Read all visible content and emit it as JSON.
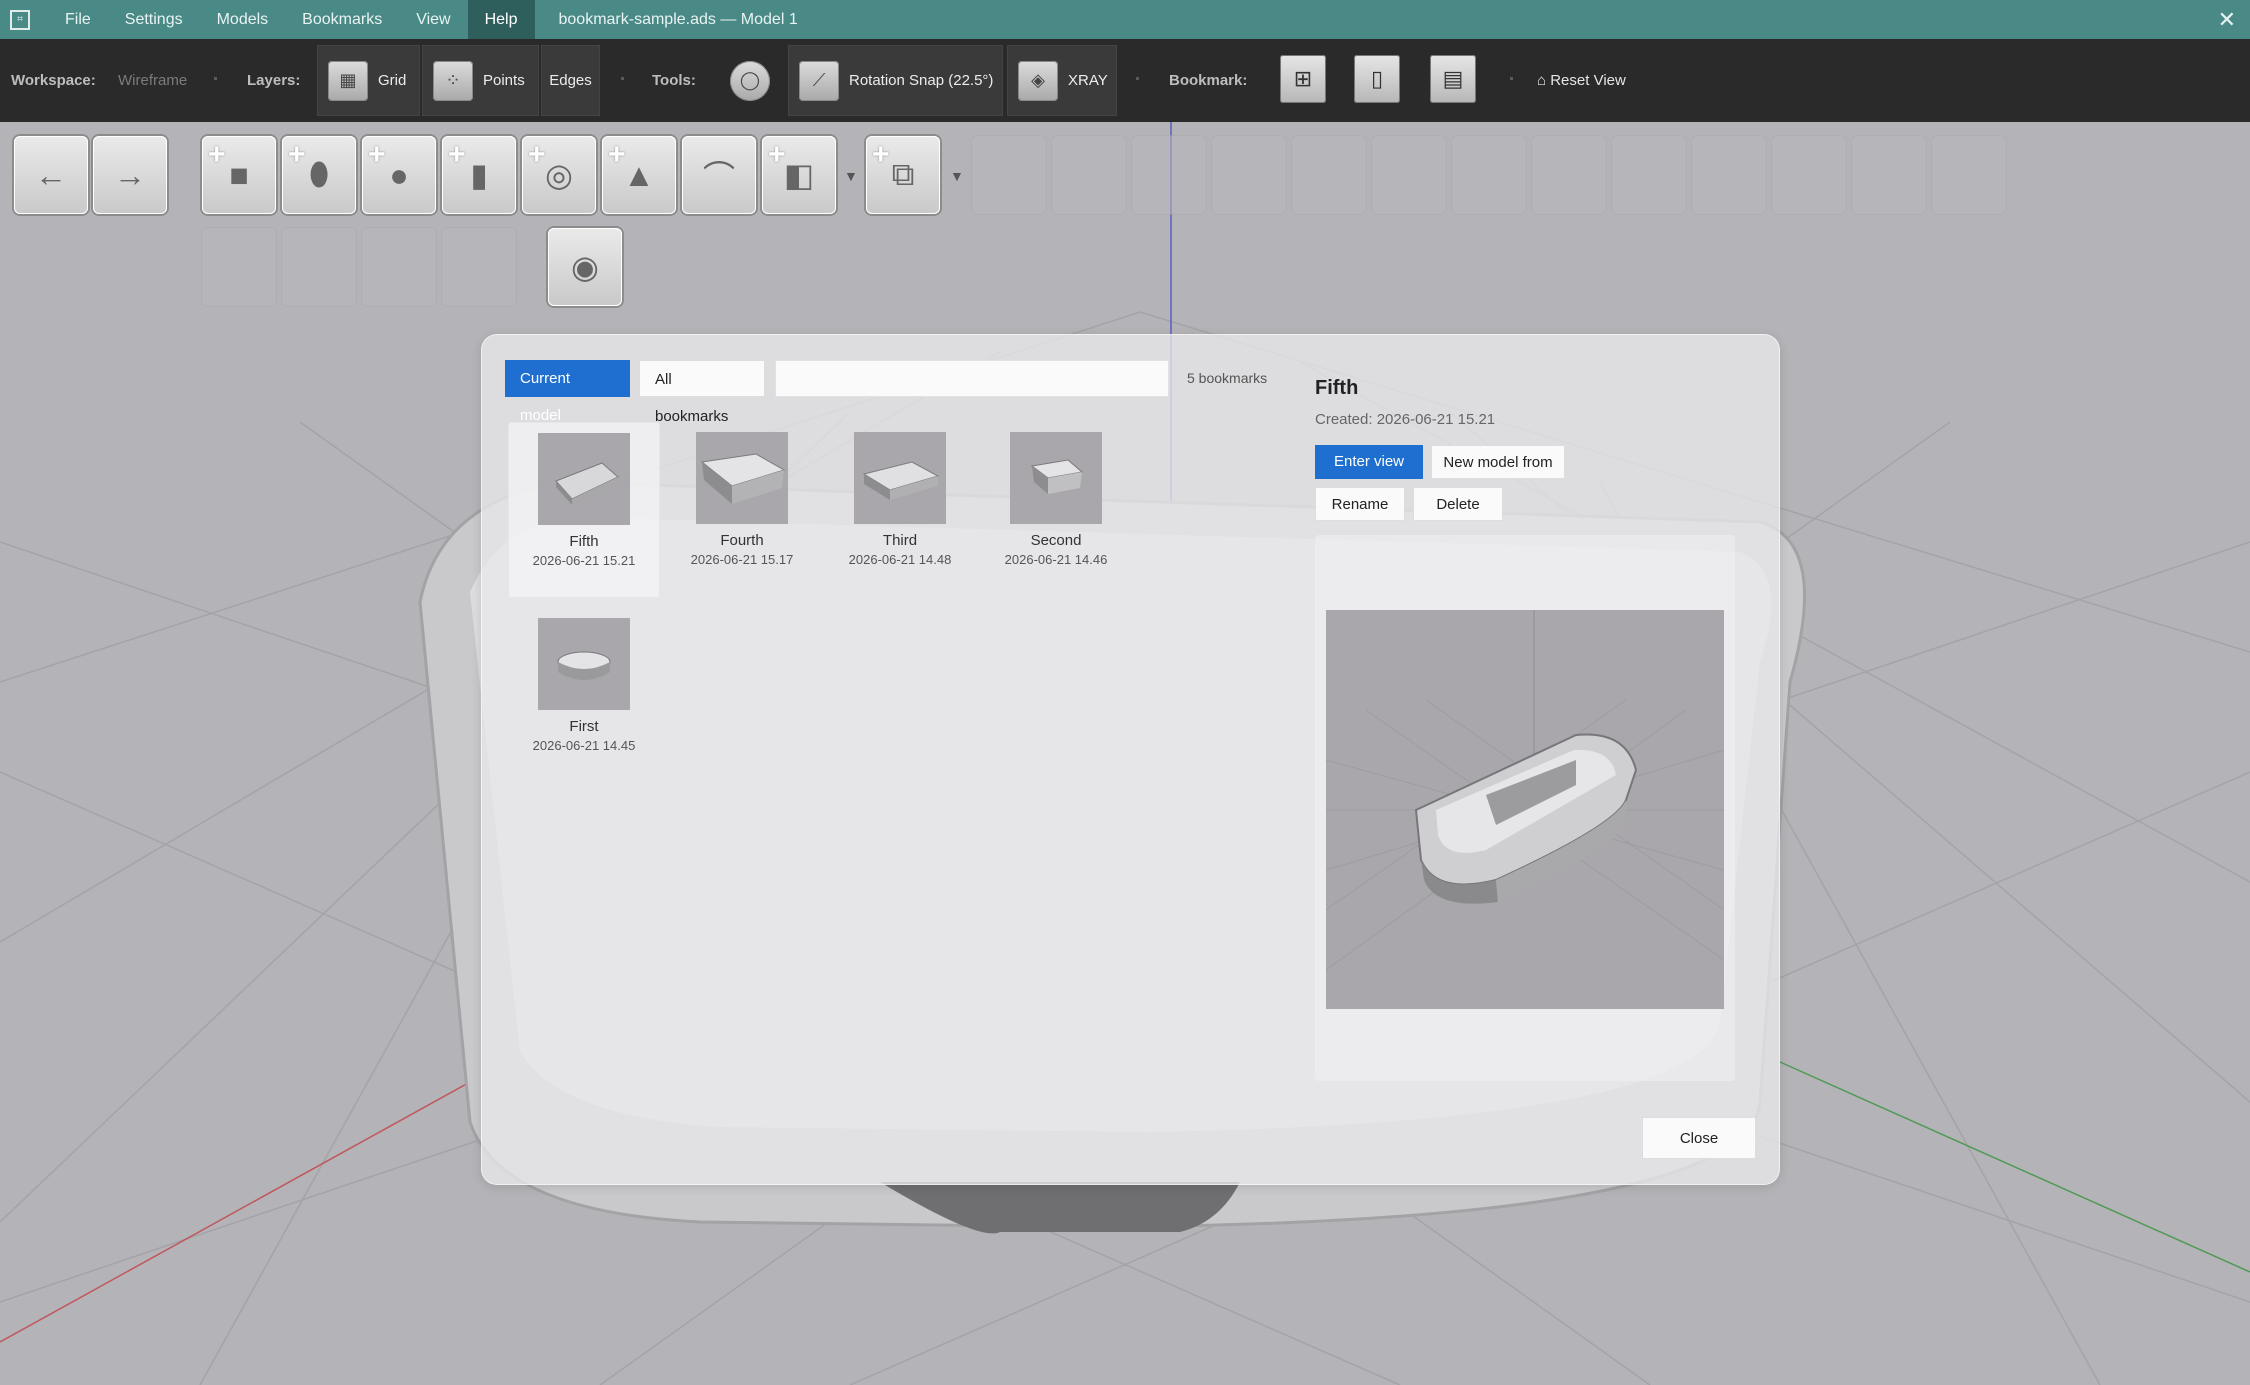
{
  "titlebar": {
    "menu": [
      "File",
      "Settings",
      "Models",
      "Bookmarks",
      "View",
      "Help"
    ],
    "active_menu": "Help",
    "window_title": "bookmark-sample.ads — Model 1",
    "close_glyph": "✕"
  },
  "toolbar": {
    "workspace_label": "Workspace:",
    "workspace_value": "Wireframe",
    "layers_label": "Layers:",
    "grid_label": "Grid",
    "points_label": "Points",
    "edges_label": "Edges",
    "tools_label": "Tools:",
    "rotation_snap_label": "Rotation Snap (22.5°)",
    "xray_label": "XRAY",
    "bookmark_label": "Bookmark:",
    "reset_view_label": "⌂ Reset View"
  },
  "dialog": {
    "tab_current": "Current model",
    "tab_all": "All bookmarks",
    "search_value": "",
    "count": "5 bookmarks",
    "bookmarks": [
      {
        "name": "Fifth",
        "date": "2026-06-21 15.21"
      },
      {
        "name": "Fourth",
        "date": "2026-06-21 15.17"
      },
      {
        "name": "Third",
        "date": "2026-06-21 14.48"
      },
      {
        "name": "Second",
        "date": "2026-06-21 14.46"
      },
      {
        "name": "First",
        "date": "2026-06-21 14.45"
      }
    ],
    "selected": {
      "title": "Fifth",
      "created": "Created: 2026-06-21 15.21"
    },
    "enter_view": "Enter view",
    "new_model_from": "New model from",
    "rename": "Rename",
    "delete": "Delete",
    "close": "Close"
  },
  "colors": {
    "titlebar": "#4a8a86",
    "toolbar": "#2a2a2a",
    "accent": "#1e6fcf",
    "viewport": "#b4b3b7"
  }
}
